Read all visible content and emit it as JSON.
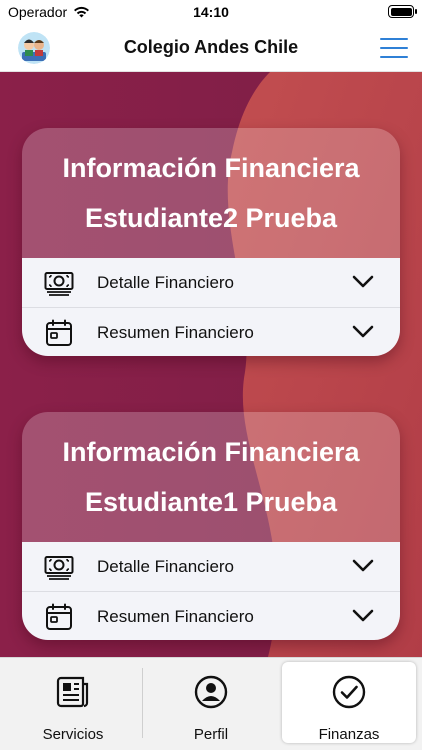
{
  "status_bar": {
    "carrier": "Operador",
    "time": "14:10",
    "battery_level": 1.0
  },
  "nav": {
    "title": "Colegio Andes Chile",
    "logo_icon": "school-logo-icon",
    "menu_icon": "hamburger-menu-icon",
    "accent_color": "#2f80d6"
  },
  "background": {
    "colors": [
      "#8d2449",
      "#a8344c",
      "#b84a4a"
    ]
  },
  "cards": [
    {
      "title_line1": "Información Financiera",
      "title_line2": "Estudiante2 Prueba",
      "rows": [
        {
          "label": "Detalle Financiero",
          "icon": "money-icon"
        },
        {
          "label": "Resumen Financiero",
          "icon": "calendar-icon"
        }
      ]
    },
    {
      "title_line1": "Información Financiera",
      "title_line2": "Estudiante1 Prueba",
      "rows": [
        {
          "label": "Detalle Financiero",
          "icon": "money-icon"
        },
        {
          "label": "Resumen Financiero",
          "icon": "calendar-icon"
        }
      ]
    }
  ],
  "tabs": [
    {
      "label": "Servicios",
      "icon": "newspaper-icon",
      "active": false
    },
    {
      "label": "Perfil",
      "icon": "profile-icon",
      "active": false
    },
    {
      "label": "Finanzas",
      "icon": "check-circle-icon",
      "active": true
    }
  ]
}
